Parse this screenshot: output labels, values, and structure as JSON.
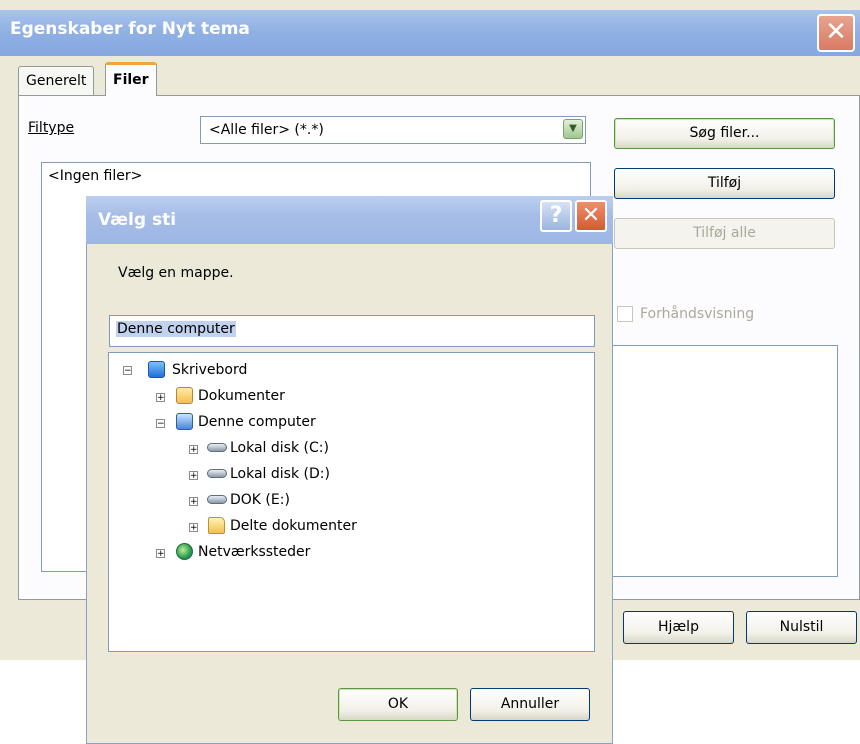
{
  "main_window": {
    "title": "Egenskaber for Nyt tema",
    "close_symbol": "✕",
    "tabs": [
      {
        "label": "Generelt",
        "active": false
      },
      {
        "label": "Filer",
        "active": true
      }
    ],
    "filetype_label": "Filtype",
    "filetype_value": "<Alle filer> (*.*)",
    "file_list_text": "<Ingen filer>",
    "buttons": {
      "search_files": "Søg filer...",
      "add": "Tilføj",
      "add_all": "Tilføj alle",
      "help": "Hjælp",
      "reset": "Nulstil"
    },
    "preview_label": "Forhåndsvisning"
  },
  "dialog": {
    "title": "Vælg sti",
    "help_symbol": "?",
    "close_symbol": "✕",
    "prompt": "Vælg en mappe.",
    "path_value": "Denne computer",
    "tree": [
      {
        "label": "Skrivebord",
        "expander": "−",
        "icon": "desktop-icon"
      },
      {
        "label": "Dokumenter",
        "expander": "+",
        "icon": "documents-folder-icon"
      },
      {
        "label": "Denne computer",
        "expander": "−",
        "icon": "computer-icon"
      },
      {
        "label": "Lokal disk (C:)",
        "expander": "+",
        "icon": "disk-drive-icon"
      },
      {
        "label": "Lokal disk (D:)",
        "expander": "+",
        "icon": "disk-drive-icon"
      },
      {
        "label": "DOK (E:)",
        "expander": "+",
        "icon": "disk-drive-icon"
      },
      {
        "label": "Delte dokumenter",
        "expander": "+",
        "icon": "folder-icon"
      },
      {
        "label": "Netværkssteder",
        "expander": "+",
        "icon": "network-icon"
      }
    ],
    "ok_label": "OK",
    "cancel_label": "Annuller"
  },
  "colors": {
    "window_face": "#ece9d8",
    "titlebar": "#a6bde6",
    "close_red": "#d45a34",
    "tab_accent": "#f0a43b",
    "selection": "#c1d2ee"
  }
}
